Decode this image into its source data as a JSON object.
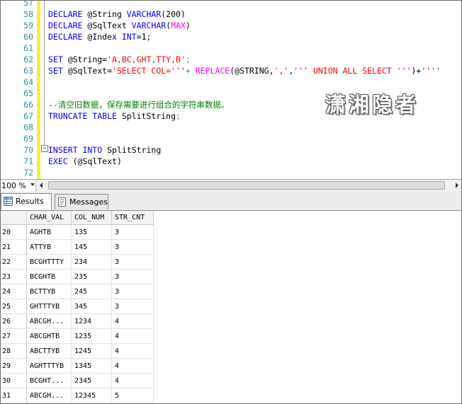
{
  "editor": {
    "lines": [
      {
        "num": "57",
        "tokens": []
      },
      {
        "num": "58",
        "tokens": [
          {
            "t": "DECLARE",
            "c": "kw"
          },
          {
            "t": " @String ",
            "c": ""
          },
          {
            "t": "VARCHAR",
            "c": "kw"
          },
          {
            "t": "(200)",
            "c": ""
          }
        ]
      },
      {
        "num": "59",
        "tokens": [
          {
            "t": "DECLARE",
            "c": "kw"
          },
          {
            "t": " @SqlText ",
            "c": ""
          },
          {
            "t": "VARCHAR",
            "c": "kw"
          },
          {
            "t": "(",
            "c": ""
          },
          {
            "t": "MAX",
            "c": "fn"
          },
          {
            "t": ")",
            "c": ""
          }
        ]
      },
      {
        "num": "60",
        "tokens": [
          {
            "t": "DECLARE",
            "c": "kw"
          },
          {
            "t": " @Index ",
            "c": ""
          },
          {
            "t": "INT",
            "c": "kw"
          },
          {
            "t": "=1;",
            "c": ""
          }
        ]
      },
      {
        "num": "61",
        "tokens": []
      },
      {
        "num": "62",
        "tokens": [
          {
            "t": "SET",
            "c": "kw"
          },
          {
            "t": " @String=",
            "c": ""
          },
          {
            "t": "'A,BC,GHT,TTY,B'",
            "c": "str"
          },
          {
            "t": ";",
            "c": "op"
          }
        ]
      },
      {
        "num": "63",
        "tokens": [
          {
            "t": "SET",
            "c": "kw"
          },
          {
            "t": " @SqlText=",
            "c": ""
          },
          {
            "t": "'SELECT COL='''",
            "c": "str"
          },
          {
            "t": "+ ",
            "c": "op"
          },
          {
            "t": "REPLACE",
            "c": "fn"
          },
          {
            "t": "(@STRING,",
            "c": ""
          },
          {
            "t": "','",
            "c": "str"
          },
          {
            "t": ",",
            "c": ""
          },
          {
            "t": "''' UNION ALL SELECT '''",
            "c": "str"
          },
          {
            "t": ")+",
            "c": ""
          },
          {
            "t": "''''",
            "c": "str"
          }
        ]
      },
      {
        "num": "64",
        "tokens": []
      },
      {
        "num": "65",
        "tokens": []
      },
      {
        "num": "66",
        "tokens": [
          {
            "t": "--清空旧数据，保存需要进行组合的字符串数据。",
            "c": "cm"
          }
        ]
      },
      {
        "num": "67",
        "tokens": [
          {
            "t": "TRUNCATE TABLE",
            "c": "kw"
          },
          {
            "t": " SplitString",
            "c": ""
          },
          {
            "t": ";",
            "c": "op"
          }
        ]
      },
      {
        "num": "68",
        "tokens": []
      },
      {
        "num": "69",
        "tokens": []
      },
      {
        "num": "70",
        "tokens": [
          {
            "t": "INSERT INTO",
            "c": "kw"
          },
          {
            "t": " SplitString",
            "c": ""
          }
        ]
      },
      {
        "num": "71",
        "tokens": [
          {
            "t": "EXEC",
            "c": "kw"
          },
          {
            "t": " (@SqlText)",
            "c": ""
          }
        ]
      },
      {
        "num": "72",
        "tokens": []
      }
    ],
    "watermark": "潇湘隐者"
  },
  "zoom": {
    "value": "100 %"
  },
  "tabs": [
    {
      "label": "Results",
      "icon": "grid-icon",
      "active": true
    },
    {
      "label": "Messages",
      "icon": "messages-icon",
      "active": false
    }
  ],
  "grid": {
    "columns": [
      "",
      "CHAR_VAL",
      "COL_NUM",
      "STR_CNT"
    ],
    "rows": [
      [
        "20",
        "AGHTB",
        "135",
        "3"
      ],
      [
        "21",
        "ATTYB",
        "145",
        "3"
      ],
      [
        "22",
        "BCGHTTTY",
        "234",
        "3"
      ],
      [
        "23",
        "BCGHTB",
        "235",
        "3"
      ],
      [
        "24",
        "BCTTYB",
        "245",
        "3"
      ],
      [
        "25",
        "GHTTTYB",
        "345",
        "3"
      ],
      [
        "26",
        "ABCGH...",
        "1234",
        "4"
      ],
      [
        "27",
        "ABCGHTB",
        "1235",
        "4"
      ],
      [
        "28",
        "ABCTTYB",
        "1245",
        "4"
      ],
      [
        "29",
        "AGHTTTYB",
        "1345",
        "4"
      ],
      [
        "30",
        "BCGHT...",
        "2345",
        "4"
      ],
      [
        "31",
        "ABCGH...",
        "12345",
        "5"
      ]
    ]
  },
  "colors": {
    "keyword": "#0000ff",
    "string": "#ff0000",
    "function": "#ff00ff",
    "comment": "#008000",
    "line_number": "#2b91af",
    "change_bar": "#f5ed45"
  }
}
